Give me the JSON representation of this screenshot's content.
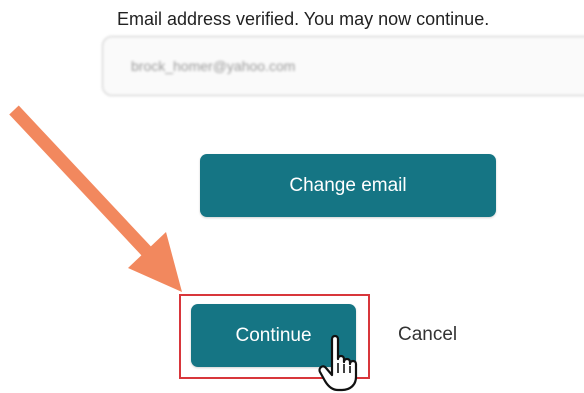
{
  "status": {
    "message": "Email address verified. You may now continue."
  },
  "email_field": {
    "value": "brock_homer@yahoo.com"
  },
  "buttons": {
    "change_email": "Change email",
    "continue": "Continue",
    "cancel": "Cancel"
  },
  "colors": {
    "button_bg": "#157584",
    "arrow": "#f2885e",
    "highlight_border": "#d8363b"
  },
  "icons": {
    "annotation_arrow": "arrow-icon",
    "pointer": "hand-pointer-icon"
  }
}
